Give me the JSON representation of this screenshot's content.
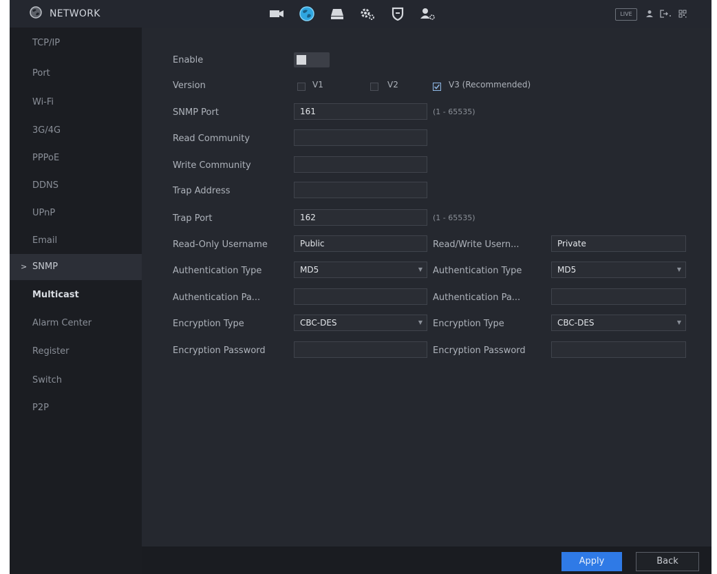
{
  "header": {
    "title": "NETWORK",
    "live_label": "LIVE",
    "nav_icons": [
      "camera-icon",
      "network-globe-icon",
      "storage-icon",
      "system-gears-icon",
      "security-shield-icon",
      "account-icon"
    ],
    "active_nav": "network-globe-icon"
  },
  "sidebar": {
    "items": [
      {
        "label": "TCP/IP"
      },
      {
        "label": "Port"
      },
      {
        "label": "Wi-Fi"
      },
      {
        "label": "3G/4G"
      },
      {
        "label": "PPPoE"
      },
      {
        "label": "DDNS"
      },
      {
        "label": "UPnP"
      },
      {
        "label": "Email"
      },
      {
        "label": "SNMP",
        "active": true,
        "arrow": ">"
      },
      {
        "label": "Multicast"
      },
      {
        "label": "Alarm Center"
      },
      {
        "label": "Register"
      },
      {
        "label": "Switch"
      },
      {
        "label": "P2P"
      }
    ]
  },
  "form": {
    "enable_label": "Enable",
    "enable_on": false,
    "version_label": "Version",
    "v1_label": "V1",
    "v2_label": "V2",
    "v3_label": "V3 (Recommended)",
    "v1_checked": false,
    "v2_checked": false,
    "v3_checked": true,
    "snmp_port_label": "SNMP Port",
    "snmp_port_value": "161",
    "snmp_port_range": "(1 - 65535)",
    "read_community_label": "Read Community",
    "read_community_value": "",
    "write_community_label": "Write Community",
    "write_community_value": "",
    "trap_address_label": "Trap Address",
    "trap_address_value": "",
    "trap_port_label": "Trap Port",
    "trap_port_value": "162",
    "trap_port_range": "(1 - 65535)",
    "left": {
      "username_label": "Read-Only Username",
      "username_value": "Public",
      "auth_type_label": "Authentication Type",
      "auth_type_value": "MD5",
      "auth_pass_label": "Authentication Pa...",
      "auth_pass_value": "",
      "enc_type_label": "Encryption Type",
      "enc_type_value": "CBC-DES",
      "enc_pass_label": "Encryption Password",
      "enc_pass_value": ""
    },
    "right": {
      "username_label": "Read/Write Usern...",
      "username_value": "Private",
      "auth_type_label": "Authentication Type",
      "auth_type_value": "MD5",
      "auth_pass_label": "Authentication Pa...",
      "auth_pass_value": "",
      "enc_type_label": "Encryption Type",
      "enc_type_value": "CBC-DES",
      "enc_pass_label": "Encryption Password",
      "enc_pass_value": ""
    }
  },
  "footer": {
    "apply_label": "Apply",
    "back_label": "Back"
  },
  "colors": {
    "accent": "#2f7ae6",
    "background": "#25282f",
    "sidebar": "#1b1d22",
    "active_nav": "#2fa6e0"
  }
}
